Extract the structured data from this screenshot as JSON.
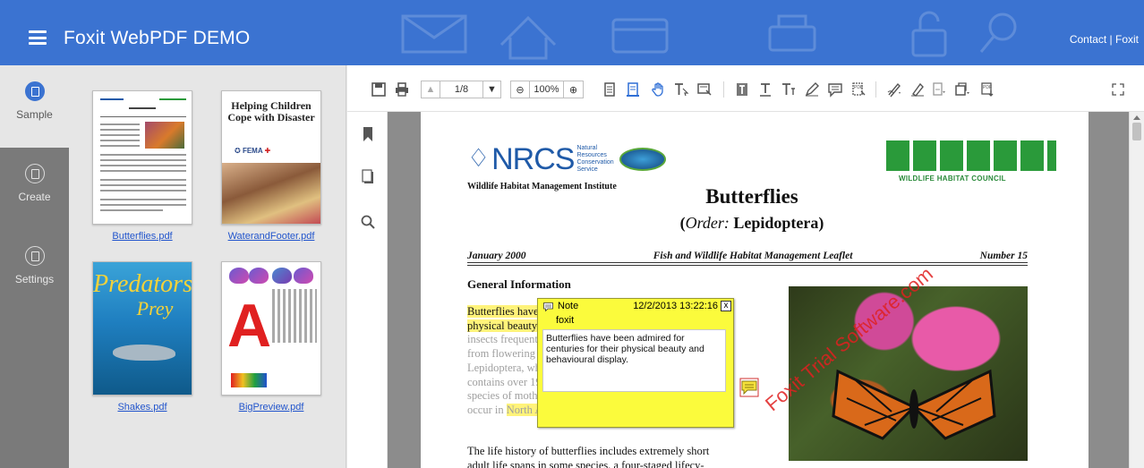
{
  "header": {
    "title": "Foxit WebPDF DEMO",
    "links": "Contact | Foxit"
  },
  "rail": {
    "items": [
      {
        "label": "Sample",
        "active": true
      },
      {
        "label": "Create",
        "active": false
      },
      {
        "label": "Settings",
        "active": false
      }
    ]
  },
  "thumbs": {
    "files": [
      {
        "name": "Butterflies.pdf"
      },
      {
        "name": "WaterandFooter.pdf"
      },
      {
        "name": "Shakes.pdf"
      },
      {
        "name": "BigPreview.pdf"
      }
    ],
    "helping_title": "Helping Children Cope with Disaster",
    "fema": "FEMA",
    "predators_title": "Predators",
    "predators_sub": "Prey"
  },
  "toolbar": {
    "page_indicator": "1/8",
    "zoom_level": "100%"
  },
  "document": {
    "nrcs_mark": "NRCS",
    "nrcs_sub": [
      "Natural",
      "Resources",
      "Conservation",
      "Service"
    ],
    "whmi": "Wildlife Habitat Management Institute",
    "whc": "WILDLIFE HABITAT COUNCIL",
    "title": "Butterflies",
    "subtitle_order": "Order:",
    "subtitle_name": "Lepidoptera",
    "date": "January 2000",
    "leaflet": "Fish and Wildlife Habitat Management Leaflet",
    "number": "Number 15",
    "section": "General Information",
    "para1_hl": "Butterflies have been admired for centuries for their physical beauty and behavioural display.",
    "para1_rest_a": " These colorful insects frequent gardens, grassy fields, and feed on nectar from flowering plants. Butterflies belong to the order Lepidoptera, which means scale-winged. The order contains over 19,000 species of butterflies and 100,000 species of moths worldwide. Over 700 butterfly species occur in ",
    "para1_na": "North America.",
    "para2": "The life history of butterflies includes extremely short adult life spans in some species, a four-staged lifecy-",
    "watermark": "Foxit Trial Software.com"
  },
  "note": {
    "type": "Note",
    "date": "12/2/2013 13:22:16",
    "author": "foxit",
    "body": "Butterflies have been admired for centuries for their physical beauty and behavioural display.",
    "close": "x"
  },
  "colors": {
    "header": "#3b73d1",
    "rail": "#7a7a7a",
    "note_yellow": "#fbfb3c",
    "highlight": "#fff37a"
  }
}
